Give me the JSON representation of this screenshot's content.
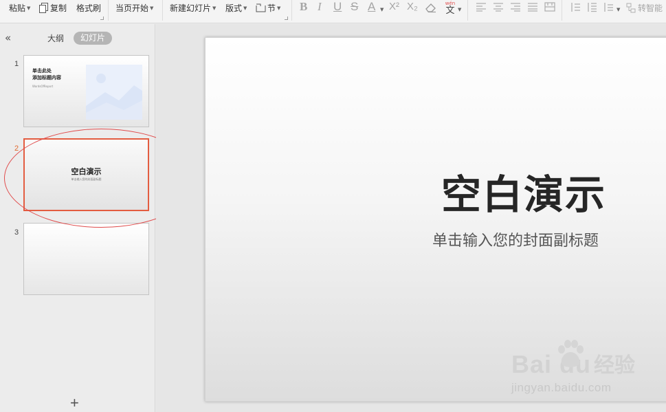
{
  "toolbar": {
    "paste": "粘贴",
    "copy": "复制",
    "format_painter": "格式刷",
    "from_current": "当页开始",
    "new_slide": "新建幻灯片",
    "layout": "版式",
    "section": "节",
    "bold": "B",
    "italic": "I",
    "underline": "U",
    "strike": "S",
    "font_color": "A",
    "superscript": "X²",
    "subscript": "X₂",
    "pinyin_top": "wén",
    "pinyin_bottom": "文",
    "convert": "转智能"
  },
  "panel": {
    "collapse_icon": "«",
    "outline_tab": "大纲",
    "slides_tab": "幻灯片",
    "add_slide_icon": "+"
  },
  "slides": [
    {
      "number": "1",
      "title": "单击此处\n添加标题内容",
      "subtitle": "WordsOfReport"
    },
    {
      "number": "2",
      "title": "空白演示",
      "subtitle": "单击输入您的封面副标题",
      "selected": true
    },
    {
      "number": "3",
      "title": "",
      "subtitle": ""
    }
  ],
  "main_slide": {
    "title": "空白演示",
    "subtitle": "单击输入您的封面副标题"
  },
  "watermark": {
    "brand_latin": "Bai du",
    "brand_cn": "经验",
    "url": "jingyan.baidu.com"
  },
  "colors": {
    "selection_border": "#e35c40",
    "annotation_ellipse": "#e04b4b",
    "active_number": "#e0692e"
  }
}
